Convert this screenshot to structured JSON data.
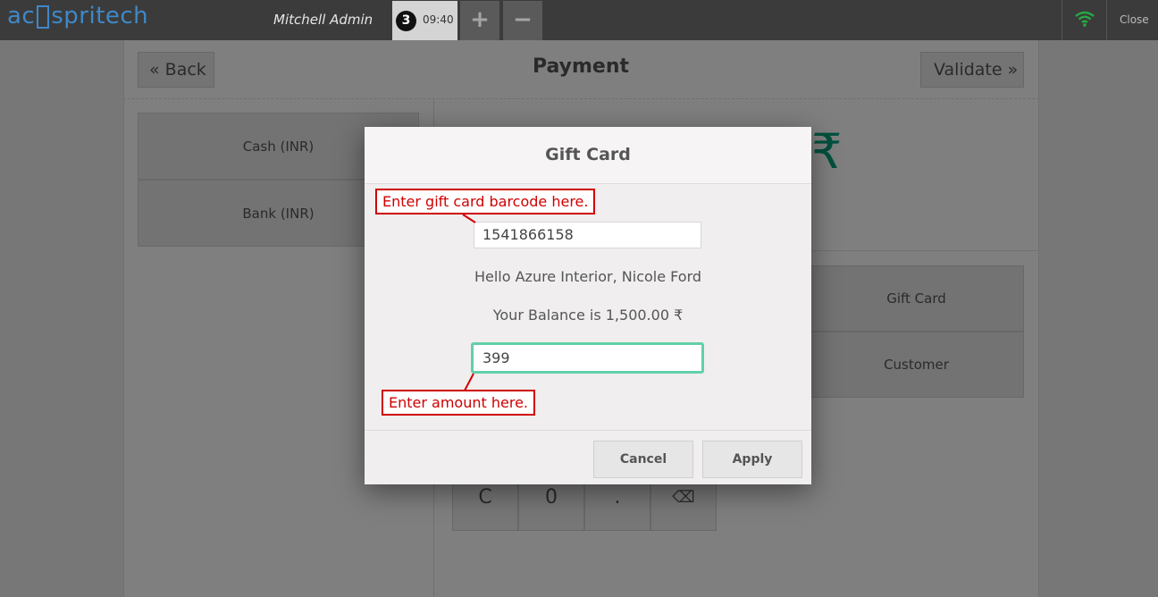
{
  "topbar": {
    "logo": {
      "part1": "ac",
      "part2": "spritech"
    },
    "cashier": "Mitchell Admin",
    "order": {
      "number": "3",
      "time": "09:40"
    },
    "add_symbol": "+",
    "remove_symbol": "−",
    "close_label": "Close",
    "wifi_color": "#27a844"
  },
  "payment": {
    "back_label": "« Back",
    "title": "Payment",
    "validate_label": "Validate »",
    "methods": [
      "Cash (INR)",
      "Bank (INR)"
    ],
    "currency_symbol": "₹",
    "side_buttons": [
      "Gift Card",
      "Customer"
    ],
    "numpad": [
      "C",
      "0",
      ".",
      "⌫"
    ]
  },
  "modal": {
    "title": "Gift Card",
    "barcode_value": "1541866158",
    "greeting": "Hello Azure Interior, Nicole Ford",
    "balance_text": "Your Balance is 1,500.00 ₹",
    "amount_value": "399",
    "cancel_label": "Cancel",
    "apply_label": "Apply"
  },
  "annotations": {
    "barcode_hint": "Enter gift card barcode here.",
    "amount_hint": "Enter amount here."
  },
  "colors": {
    "accent": "#00a07a",
    "focus_border": "#62d0a8",
    "annotation": "#d00000"
  }
}
